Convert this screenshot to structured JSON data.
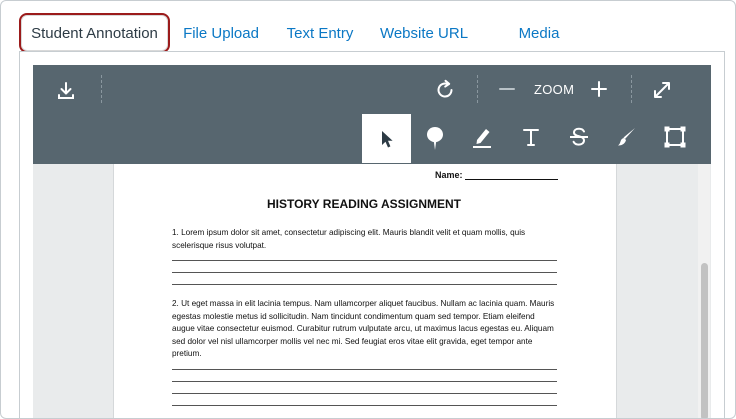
{
  "tabs": [
    {
      "label": "Student Annotation",
      "active": true
    },
    {
      "label": "File Upload"
    },
    {
      "label": "Text Entry"
    },
    {
      "label": "Website URL"
    },
    {
      "label": "Media"
    }
  ],
  "toolbar": {
    "zoom_label": "ZOOM",
    "icons": [
      "download-icon",
      "rotate-icon",
      "zoom-out-icon",
      "zoom-in-icon",
      "fullscreen-icon",
      "pointer-icon",
      "pin-icon",
      "highlight-icon",
      "text-icon",
      "strikeout-icon",
      "draw-icon",
      "area-icon"
    ],
    "active_tool": "pointer"
  },
  "document": {
    "name_label": "Name:",
    "title": "HISTORY READING ASSIGNMENT",
    "question1": "1. Lorem ipsum dolor sit amet, consectetur adipiscing elit. Mauris blandit velit et quam mollis, quis scelerisque risus volutpat.",
    "question2": "2. Ut eget massa in elit lacinia tempus. Nam ullamcorper aliquet faucibus. Nullam ac lacinia quam. Mauris egestas molestie metus id sollicitudin. Nam tincidunt condimentum quam sed tempor. Etiam eleifend augue vitae consectetur euismod. Curabitur rutrum vulputate arcu, ut maximus lacus egestas eu. Aliquam sed dolor vel nisl ullamcorper mollis vel nec mi. Sed feugiat eros vitae elit gravida, eget tempor ante pretium."
  },
  "colors": {
    "toolbar_bg": "#57666f",
    "tab_link": "#0b78c5",
    "active_tab_border": "#9b1b1b",
    "doc_bg": "#e9ebec"
  }
}
